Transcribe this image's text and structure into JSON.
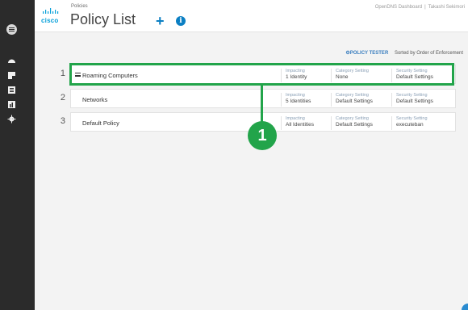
{
  "sidebar": {
    "icons": [
      "menu-icon",
      "dashboard-icon",
      "reporting-icon",
      "policies-icon",
      "chart-icon",
      "settings-icon"
    ]
  },
  "header": {
    "logo_text": "cisco",
    "breadcrumb": "Policies",
    "title": "Policy List",
    "add_symbol": "+",
    "info_symbol": "i",
    "dashboard_link": "OpenDNS Dashboard",
    "user_name": "Takashi Sekimori"
  },
  "toolbar": {
    "tester_label": "⚙POLICY TESTER",
    "sort_label": "Sorted by Order of Enforcement"
  },
  "policies": [
    {
      "num": "1",
      "name": "Roaming Computers",
      "impacting_label": "Impacting",
      "impacting": "1 Identity",
      "category_label": "Category Setting",
      "category": "None",
      "security_label": "Security Setting",
      "security": "Default Settings"
    },
    {
      "num": "2",
      "name": "Networks",
      "impacting_label": "Impacting",
      "impacting": "5 Identities",
      "category_label": "Category Setting",
      "category": "Default Settings",
      "security_label": "Security Setting",
      "security": "Default Settings"
    },
    {
      "num": "3",
      "name": "Default Policy",
      "impacting_label": "Impacting",
      "impacting": "All Identities",
      "category_label": "Category Setting",
      "category": "Default Settings",
      "security_label": "Security Setting",
      "security": "executeban"
    }
  ],
  "annotation": {
    "callout_number": "1",
    "highlight_color": "#22a44a"
  },
  "colors": {
    "sidebar_bg": "#2b2b2b",
    "accent_blue": "#0b7fc3",
    "content_bg": "#f3f3f3"
  }
}
